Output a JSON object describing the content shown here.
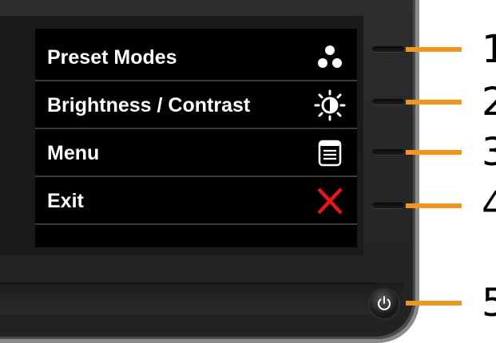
{
  "osd_menu": {
    "items": [
      {
        "label": "Preset Modes",
        "icon": "preset-modes-icon"
      },
      {
        "label": "Brightness / Contrast",
        "icon": "brightness-contrast-icon"
      },
      {
        "label": "Menu",
        "icon": "menu-icon"
      },
      {
        "label": "Exit",
        "icon": "exit-x-icon"
      }
    ]
  },
  "callouts": [
    "1",
    "2",
    "3",
    "4",
    "5"
  ],
  "colors": {
    "callout": "#f0961e",
    "exit_icon": "#e8151b",
    "osd_text": "#ffffff",
    "osd_background": "#000000"
  }
}
